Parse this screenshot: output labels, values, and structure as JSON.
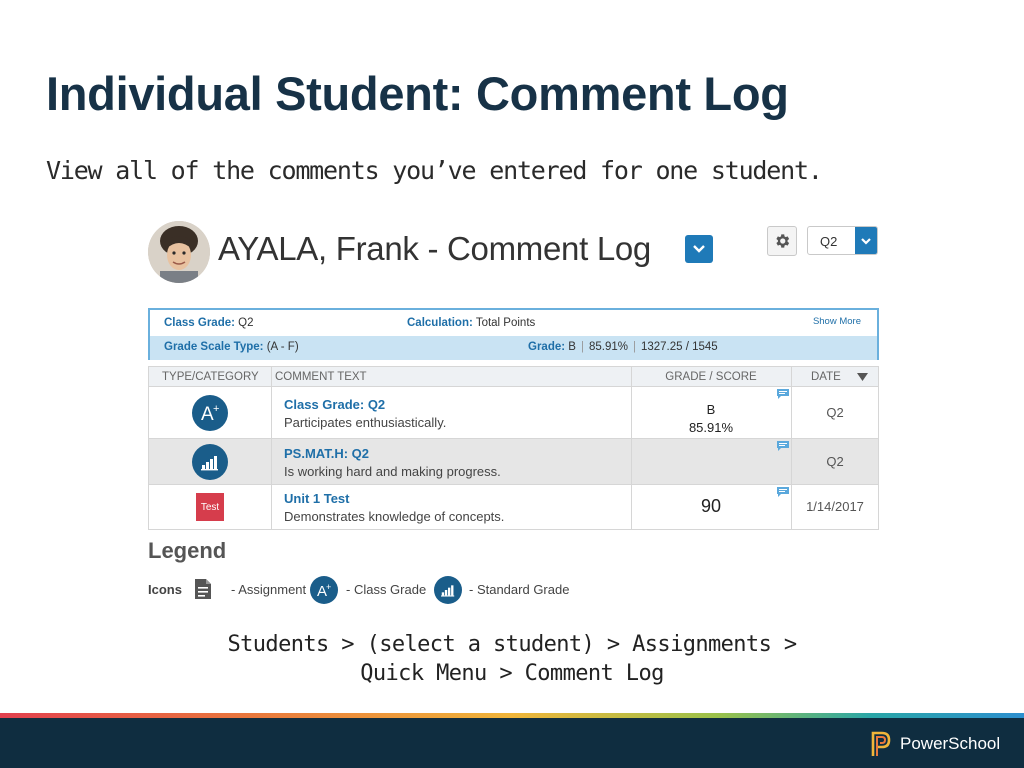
{
  "slide": {
    "title": "Individual Student: Comment Log",
    "subtitle": "View all of the comments you’ve entered for one student."
  },
  "header": {
    "heading": "AYALA, Frank - Comment Log",
    "term_value": "Q2"
  },
  "summary": {
    "class_grade_label": "Class Grade:",
    "class_grade_value": "Q2",
    "calculation_label": "Calculation:",
    "calculation_value": "Total Points",
    "show_more": "Show More",
    "scale_label": "Grade Scale Type:",
    "scale_value": "(A - F)",
    "grade_label": "Grade:",
    "grade_letter": "B",
    "grade_percent": "85.91%",
    "grade_points": "1327.25 / 1545"
  },
  "table": {
    "columns": [
      "TYPE/CATEGORY",
      "COMMENT TEXT",
      "GRADE / SCORE",
      "DATE"
    ],
    "rows": [
      {
        "icon": "class-grade-icon",
        "title": "Class Grade: Q2",
        "text": "Participates enthusiastically.",
        "grade": "B",
        "score": "85.91%",
        "date": "Q2"
      },
      {
        "icon": "standard-grade-icon",
        "title": "PS.MAT.H: Q2",
        "text": "Is working hard and making progress.",
        "grade": "",
        "score": "",
        "date": "Q2"
      },
      {
        "icon": "Test",
        "title": "Unit 1 Test",
        "text": "Demonstrates knowledge of concepts.",
        "grade": "90",
        "score": "",
        "date": "1/14/2017"
      }
    ]
  },
  "legend": {
    "title": "Legend",
    "icons_label": "Icons",
    "assignment": "- Assignment",
    "class_grade": "- Class Grade",
    "standard_grade": "- Standard Grade"
  },
  "nav_path": {
    "line1": "Students > (select a student) > Assignments >",
    "line2": "Quick Menu > Comment Log"
  },
  "footer": {
    "brand": "PowerSchool"
  },
  "colors": {
    "title": "#173247",
    "link": "#1f6fa8",
    "accent": "#1f7ab8",
    "footer": "#0f2d40",
    "test_badge": "#d63d4c"
  }
}
